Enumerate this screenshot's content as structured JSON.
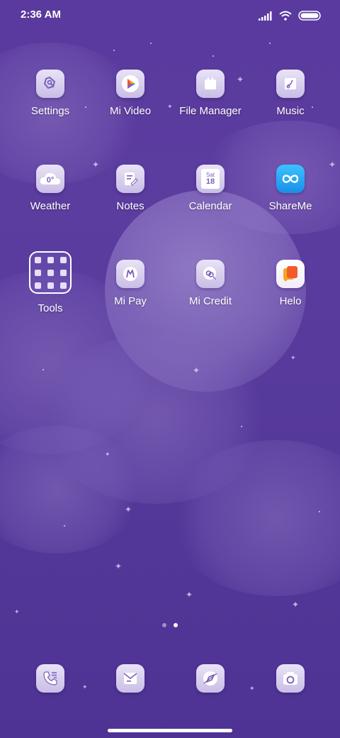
{
  "status_bar": {
    "time": "2:36 AM"
  },
  "apps": [
    {
      "label": "Settings",
      "icon": "settings-icon"
    },
    {
      "label": "Mi Video",
      "icon": "mi-video-icon"
    },
    {
      "label": "File Manager",
      "icon": "file-manager-icon"
    },
    {
      "label": "Music",
      "icon": "music-icon"
    },
    {
      "label": "Weather",
      "icon": "weather-icon",
      "icon_text": "0°"
    },
    {
      "label": "Notes",
      "icon": "notes-icon"
    },
    {
      "label": "Calendar",
      "icon": "calendar-icon",
      "icon_day": "Sat",
      "icon_date": "18"
    },
    {
      "label": "ShareMe",
      "icon": "shareme-icon"
    },
    {
      "label": "Tools",
      "icon": "folder-icon"
    },
    {
      "label": "Mi Pay",
      "icon": "mi-pay-icon"
    },
    {
      "label": "Mi Credit",
      "icon": "mi-credit-icon"
    },
    {
      "label": "Helo",
      "icon": "helo-icon"
    }
  ],
  "page_indicator": {
    "count": 2,
    "active": 2
  },
  "dock": [
    {
      "icon": "phone-icon"
    },
    {
      "icon": "messages-icon"
    },
    {
      "icon": "browser-icon"
    },
    {
      "icon": "camera-icon"
    }
  ],
  "colors": {
    "background": "#5a3a9e",
    "icon_tile": "#e0d8f3",
    "icon_glyph": "#7a5fb8",
    "mi_video_accent": "#f04a4a",
    "shareme_accent": "#1da6f0",
    "helo_accent": "#f25c2b"
  }
}
